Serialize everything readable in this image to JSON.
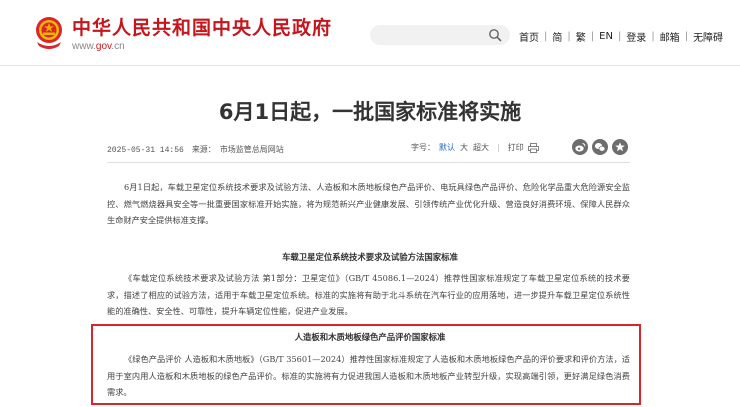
{
  "header": {
    "site_title": "中华人民共和国中央人民政府",
    "site_url_prefix": "www.",
    "site_url_gov": "gov",
    "site_url_suffix": ".cn",
    "search": {
      "placeholder": ""
    },
    "nav": [
      {
        "label": "首页"
      },
      {
        "label": "简"
      },
      {
        "label": "繁"
      },
      {
        "label": "EN"
      },
      {
        "label": "登录"
      },
      {
        "label": "邮箱"
      },
      {
        "label": "无障碍"
      }
    ]
  },
  "article": {
    "title": "6月1日起，一批国家标准将实施",
    "date": "2025-05-31 14:56",
    "source_label": "来源：",
    "source": "市场监管总局网站",
    "font_size_label": "字号：",
    "font_sizes": [
      "默认",
      "大",
      "超大"
    ],
    "print_label": "打印",
    "paragraphs": [
      "6月1日起，车载卫星定位系统技术要求及试验方法、人造板和木质地板绿色产品评价、电玩具绿色产品评价、危险化学品重大危险源安全监控、燃气燃烧器具安全等一批重要国家标准开始实施，将为规范新兴产业健康发展、引领传统产业优化升级、营造良好消费环境、保障人民群众生命财产安全提供标准支撑。",
      "《车载定位系统技术要求及试验方法 第1部分：卫星定位》（GB/T 45086.1—2024）推荐性国家标准规定了车载卫星定位系统的技术要求，描述了相应的试验方法，适用于车载卫星定位系统。标准的实施将有助于北斗系统在汽车行业的应用落地，进一步提升车载卫星定位系统性能的准确性、安全性、可靠性，提升车辆定位性能，促进产业发展。",
      "《绿色产品评价 人造板和木质地板》（GB/T 35601—2024）推荐性国家标准规定了人造板和木质地板绿色产品的评价要求和评价方法，适用于室内用人造板和木质地板的绿色产品评价。标准的实施将有力促进我国人造板和木质地板产业转型升级，实现高端引领，更好满足绿色消费需求。"
    ],
    "headings": [
      "车载卫星定位系统技术要求及试验方法国家标准",
      "人造板和木质地板绿色产品评价国家标准"
    ]
  },
  "colors": {
    "brand_red": "#c4161c",
    "highlight_border": "#d9252b",
    "link_blue": "#1f64c4"
  }
}
